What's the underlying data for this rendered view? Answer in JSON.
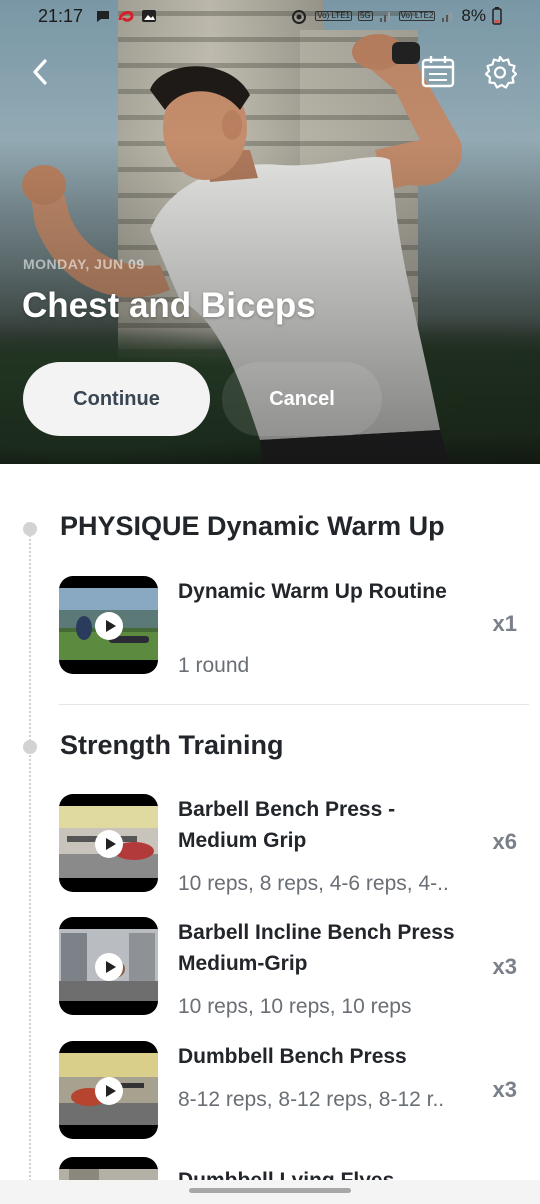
{
  "status_bar": {
    "time": "21:17",
    "battery": "8%",
    "net1": "Vo) LTE1",
    "net2": "Vo) LTE2",
    "gen": "5G"
  },
  "header": {
    "date": "MONDAY, JUN 09",
    "title": "Chest and Biceps",
    "continue_label": "Continue",
    "cancel_label": "Cancel"
  },
  "sections": [
    {
      "title": "PHYSIQUE Dynamic Warm Up",
      "exercises": [
        {
          "name": "Dynamic Warm Up Routine",
          "detail": "1 round",
          "count": "x1"
        }
      ]
    },
    {
      "title": "Strength Training",
      "exercises": [
        {
          "name": "Barbell Bench Press - Medium Grip",
          "detail": "10 reps, 8 reps, 4-6 reps, 4-..",
          "count": "x6"
        },
        {
          "name": "Barbell Incline Bench Press Medium-Grip",
          "detail": "10 reps, 10 reps, 10 reps",
          "count": "x3"
        },
        {
          "name": "Dumbbell Bench Press",
          "detail": "8-12 reps, 8-12 reps, 8-12 r..",
          "count": "x3"
        },
        {
          "name": "Dumbbell Lying Flyes",
          "detail": "",
          "count": ""
        }
      ]
    }
  ],
  "icons": {
    "back": "chevron-left-icon",
    "calendar": "calendar-icon",
    "settings": "gear-icon",
    "play": "play-icon"
  },
  "colors": {
    "title_text": "#22262b",
    "muted_text": "#6a6f75",
    "count_text": "#7a8088",
    "continue_bg": "#f3f3f3"
  }
}
